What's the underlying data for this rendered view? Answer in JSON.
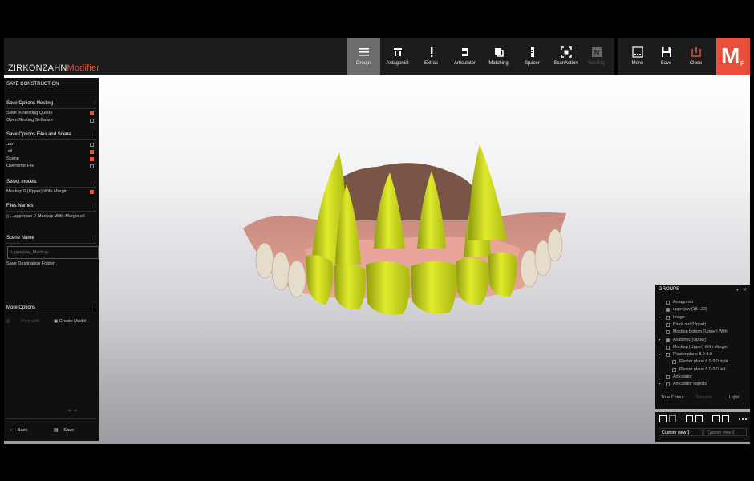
{
  "app": {
    "brand": "ZIRKONZAHN",
    "module": "Modifier",
    "logo_letter": "M",
    "logo_sub": "F",
    "accent": "#e8503a"
  },
  "toolbar": {
    "items": [
      {
        "label": "Groups",
        "icon": "list-icon",
        "active": true
      },
      {
        "label": "Antagonist",
        "icon": "antagonist-icon"
      },
      {
        "label": "Extras",
        "icon": "exclamation-icon"
      },
      {
        "label": "Articulator",
        "icon": "articulator-icon"
      },
      {
        "label": "Matching",
        "icon": "matching-icon"
      },
      {
        "label": "Spacer",
        "icon": "spacer-icon"
      },
      {
        "label": "ScanAction",
        "icon": "scan-icon"
      },
      {
        "label": "Nesting",
        "icon": "nesting-icon",
        "disabled": true
      }
    ],
    "right": [
      {
        "label": "More",
        "icon": "more-icon"
      },
      {
        "label": "Save",
        "icon": "save-icon"
      },
      {
        "label": "Close",
        "icon": "power-icon"
      }
    ]
  },
  "panel": {
    "title": "SAVE CONSTRUCTION",
    "nesting_header": "Save Options Nesting",
    "nesting_options": [
      {
        "label": "Save in Nesting Queue",
        "checked": true
      },
      {
        "label": "Open Nesting Software",
        "checked": false
      }
    ],
    "files_header": "Save Options Files and Scene",
    "file_options": [
      {
        "label": ".zzn",
        "checked": false
      },
      {
        "label": ".stl",
        "checked": true
      },
      {
        "label": "Scene",
        "checked": true
      },
      {
        "label": "Overwrite File",
        "checked": false
      }
    ],
    "models_header": "Select models",
    "models": [
      {
        "label": "Mockup 0 (Upper) With Margin",
        "checked": true
      }
    ],
    "filenames_header": "Files Names",
    "filename": "...upperjaw-0-Mockup-With-Margin.stl",
    "scene_header": "Scene Name",
    "scene_name_placeholder": "Upperjaw_Mockup",
    "destination_label": "Save Destination Folder:",
    "more_header": "More Options",
    "print_label": "Print with",
    "create_model_label": "Create Model",
    "back_label": "Back",
    "save_label": "Save"
  },
  "groups_panel": {
    "title": "GROUPS",
    "items": [
      {
        "label": "Antagonist",
        "checked": false,
        "expand": false,
        "indent": 0
      },
      {
        "label": "upperjaw (18...22)",
        "checked": true,
        "expand": false,
        "indent": 0
      },
      {
        "label": "Image",
        "checked": false,
        "expand": true,
        "indent": 0
      },
      {
        "label": "Block out (Upper)",
        "checked": false,
        "expand": false,
        "indent": 0
      },
      {
        "label": "Mockup bottom (Upper) With",
        "checked": false,
        "expand": false,
        "indent": 0
      },
      {
        "label": "Anatomic (Upper)",
        "checked": true,
        "expand": true,
        "indent": 0
      },
      {
        "label": "Mockup (Upper) With Margin",
        "checked": false,
        "expand": false,
        "indent": 0
      },
      {
        "label": "Plaster plane 8.0-9.0",
        "checked": false,
        "expand": true,
        "indent": 0
      },
      {
        "label": "Plaster plane 8.0-9.0 right",
        "checked": false,
        "expand": false,
        "indent": 1
      },
      {
        "label": "Plaster plane 8.0-9.0 left",
        "checked": false,
        "expand": false,
        "indent": 1
      },
      {
        "label": "Articulator",
        "checked": false,
        "expand": false,
        "indent": 0
      },
      {
        "label": "Articulator objects",
        "checked": false,
        "expand": true,
        "indent": 0
      }
    ],
    "footer": [
      "True Colour",
      "Textures",
      "Light"
    ],
    "views": [
      "Custom view 1",
      "Custom view 2"
    ]
  }
}
